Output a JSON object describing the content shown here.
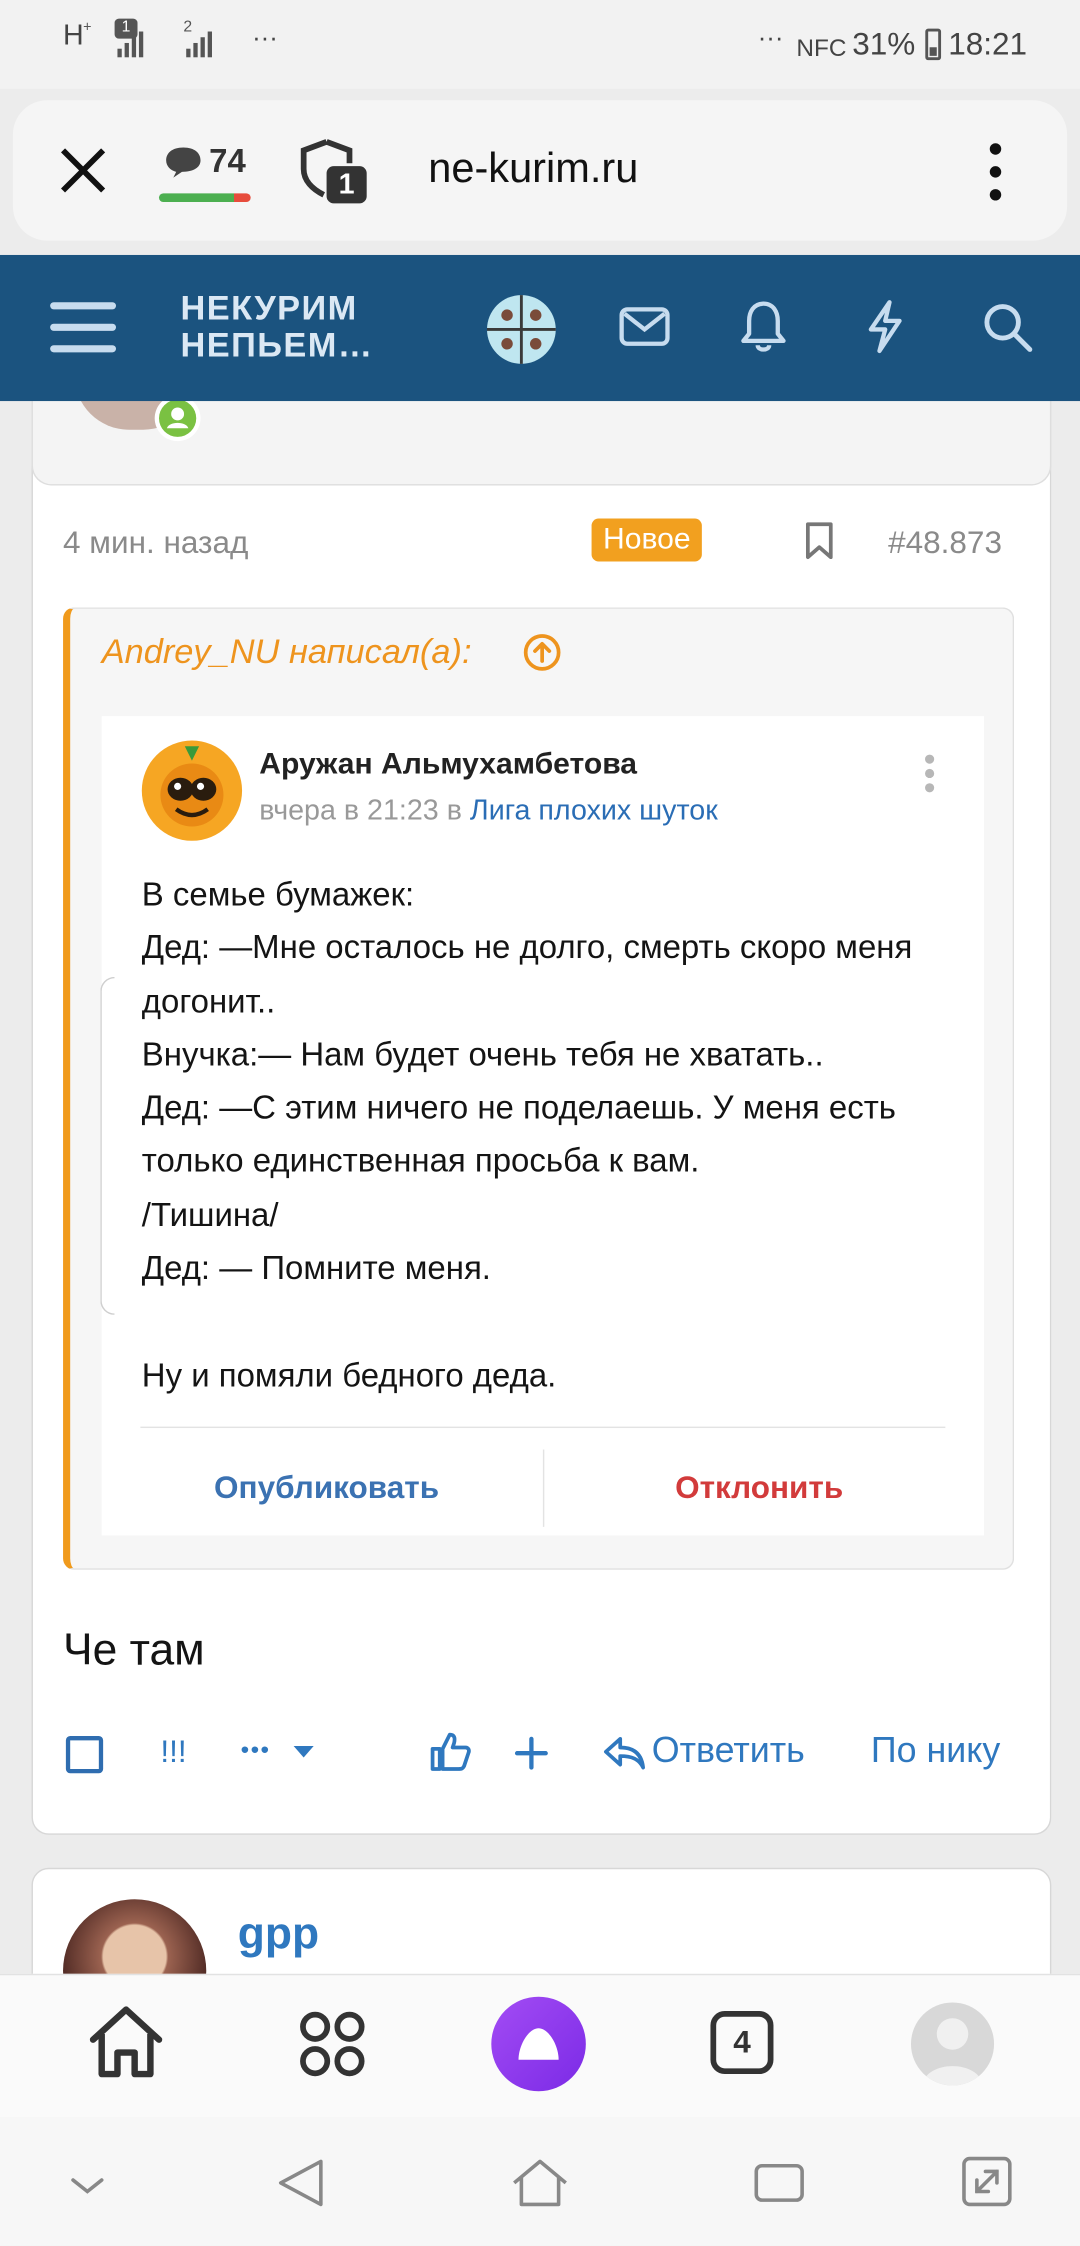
{
  "status_bar": {
    "network": "H",
    "sim1": "1",
    "sim2": "2",
    "dots_left": "···",
    "dots_right": "···",
    "nfc": "NFC",
    "battery": "31%",
    "time": "18:21"
  },
  "address_bar": {
    "comments_count": "74",
    "tabs_badge": "1",
    "url": "ne-kurim.ru"
  },
  "site_header": {
    "logo_line1": "НЕКУРИМ",
    "logo_line2": "НЕПЬЕМ…",
    "icons": [
      "menu-icon",
      "avatar-icon",
      "envelope-icon",
      "bell-icon",
      "lightning-icon",
      "search-icon"
    ],
    "accent_color": "#1b537f"
  },
  "post": {
    "time": "4 мин. назад",
    "badge": "Новое",
    "number": "#48.873",
    "quote_author": "Andrey_NU написал(а):",
    "quoted": {
      "author": "Аружан Альмухамбетова",
      "when": "вчера в 21:23",
      "in_word": "в",
      "group": "Лига плохих шуток",
      "text": "В семье бумажек:\nДед: —Мне осталось не долго, смерть скоро меня догонит..\nВнучка:— Нам будет очень тебя не хватать..\nДед: —С этим ничего не поделаешь. У меня есть только единственная просьба к вам.\n/Тишина/\nДед: — Помните меня.\n\nНу и помяли бедного деда.",
      "publish_label": "Опубликовать",
      "decline_label": "Отклонить"
    },
    "body": "Че там",
    "actions": {
      "exclaim": "!!!",
      "more": "•••",
      "reply": "Ответить",
      "by_nick": "По нику"
    }
  },
  "next_post": {
    "author": "gpp"
  },
  "browser_nav": {
    "tabs_count": "4"
  }
}
